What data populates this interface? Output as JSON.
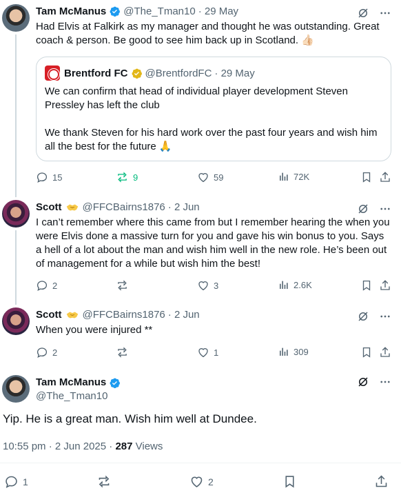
{
  "tweets": [
    {
      "name": "Tam McManus",
      "handle": "@The_Tman10",
      "date": "· 29 May",
      "text": "Had Elvis at Falkirk as my manager and thought he was outstanding. Great coach & person. Be good to see him back up in Scotland. 👍🏻",
      "quote": {
        "name": "Brentford FC",
        "handle": "@BrentfordFC",
        "date": "· 29 May",
        "text1": "We can confirm that head of individual player development Steven Pressley has left the club",
        "text2": "We thank Steven for his hard work over the past four years and wish him all the best for the future 🙏"
      },
      "replies": "15",
      "reposts": "9",
      "likes": "59",
      "views": "72K"
    },
    {
      "name": "Scott",
      "handle": "@FFCBairns1876",
      "date": "· 2 Jun",
      "text": "I can’t remember where this came from but I remember hearing the when you were Elvis done a massive turn for you and gave his win bonus to you. Says a hell of a lot about the man and wish him well in the new role. He’s been out of management for a while but wish him the best!",
      "replies": "2",
      "reposts": "",
      "likes": "3",
      "views": "2.6K"
    },
    {
      "name": "Scott",
      "handle": "@FFCBairns1876",
      "date": "· 2 Jun",
      "text": "When you were injured **",
      "replies": "2",
      "reposts": "",
      "likes": "1",
      "views": "309"
    }
  ],
  "main": {
    "name": "Tam McManus",
    "handle": "@The_Tman10",
    "text": "Yip. He is a great man. Wish him well at Dundee.",
    "time": "10:55 pm · 2 Jun 2025 · ",
    "views_count": "287",
    "views_label": " Views",
    "replies": "1",
    "reposts": "",
    "likes": "2"
  },
  "colors": {
    "verified": "#1d9bf0",
    "gold_verified": "#e2b719",
    "repost_active": "#00ba7c",
    "muted": "#536471"
  }
}
